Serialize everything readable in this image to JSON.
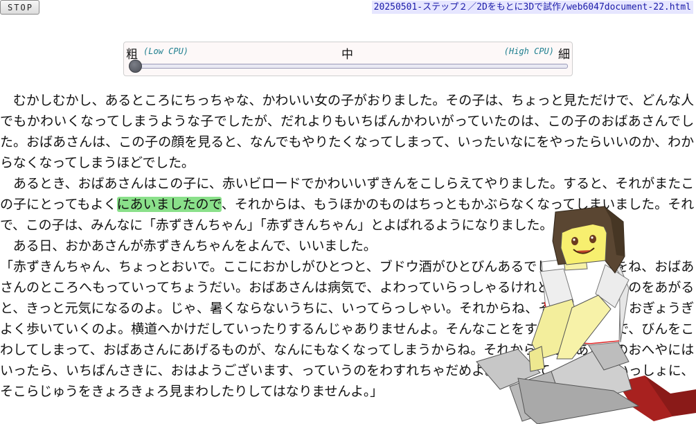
{
  "controls": {
    "stop_label": "STOP"
  },
  "header": {
    "page_path": "20250501-ステップ２／2Dをもとに3Dで試作/web6047document-22.html"
  },
  "quality_slider": {
    "coarse_label": "粗",
    "low_cpu_label": "(Low CPU)",
    "mid_label": "中",
    "high_cpu_label": "(High CPU)",
    "fine_label": "細",
    "value": 0
  },
  "story": {
    "p1": "　むかしむかし、あるところにちっちゃな、かわいい女の子がおりました。その子は、ちょっと見ただけで、どんな人でもかわいくなってしまうような子でしたが、だれよりもいちばんかわいがっていたのは、この子のおばあさんでした。おばあさんは、この子の顔を見ると、なんでもやりたくなってしまって、いったいなにをやったらいいのか、わからなくなってしまうほどでした。",
    "p2_before": "　あるとき、おばあさんはこの子に、赤いビロードでかわいいずきんをこしらえてやりました。すると、それがまたこの子にとってもよく",
    "p2_highlight": "にあいましたので",
    "p2_after": "、それからは、もうほかのものはちっともかぶらなくなってしまいました。それで、この子は、みんなに「赤ずきんちゃん」「赤ずきんちゃん」とよばれるようになりました。",
    "p3": "　ある日、おかあさんが赤ずきんちゃんをよんで、いいました。",
    "p4": "「赤ずきんちゃん、ちょっとおいで。ここにおかしがひとつと、ブドウ酒がひとびんあるでしょう。これをね、おばあさんのところへもっていってちょうだい。おばあさんは病気で、よわっていらっしゃるけれど、こういうものをあがると、きっと元気になるのよ。じゃ、暑くならないうちに、いってらっしゃい。それからね、そとへでたら、おぎょうぎよく歩いていくのよ。横道へかけだしていったりするんじゃありませんよ。そんなことをすれば、ころんで、びんをこわしてしまって、おばあさんにあげるものが、なんにもなくなってしまうからね。それから、おばあさんのおへやにはいったら、いちばんさきに、おはようございます、っていうのをわすれちゃだめよ。そうして、はいるといっしょに、そこらじゅうをきょろきょろ見まわしたりしてはなりませんよ。」"
  },
  "colors": {
    "highlight": "#8ae08a",
    "title_bg": "#e6e6ff",
    "title_text": "#1a1aa8",
    "cpu_label": "#1f7f8f"
  }
}
